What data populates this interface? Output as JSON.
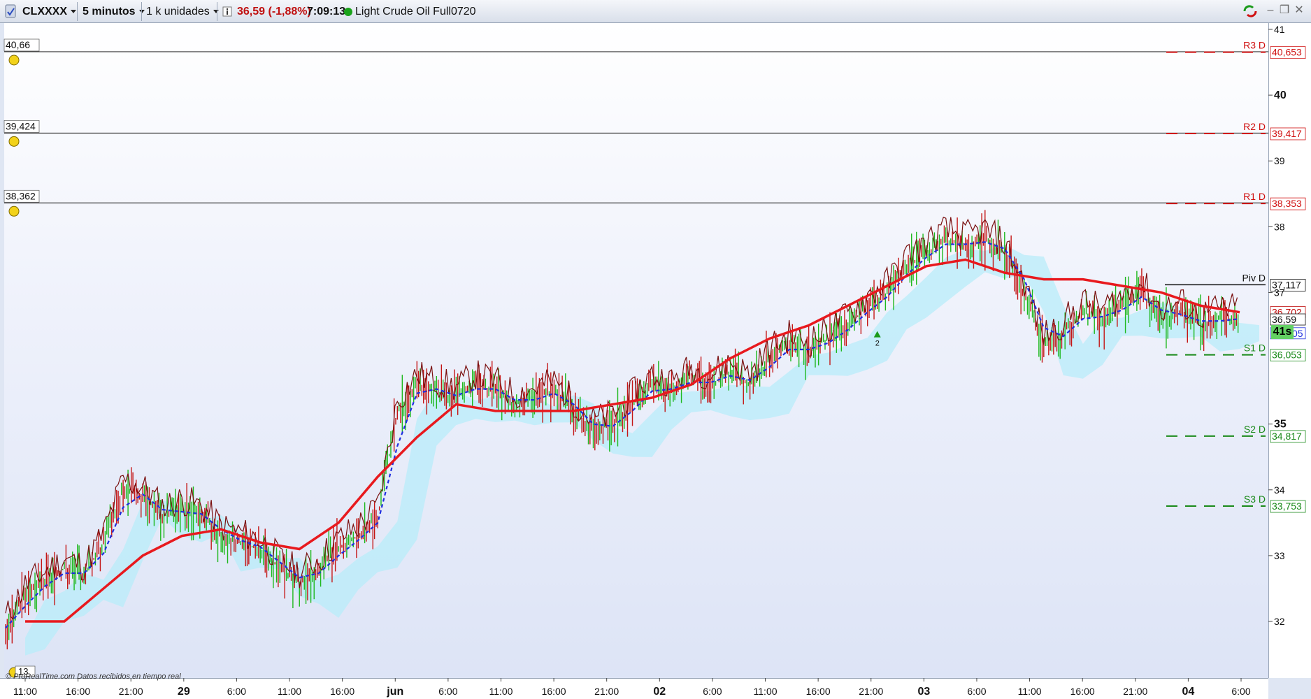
{
  "toolbar": {
    "symbol": "CLXXXX",
    "interval": "5 minutos",
    "units": "1 k unidades",
    "info_icon": "info-icon",
    "last_price": "36,59 (-1,88%)",
    "time": "7:09:13",
    "status_color": "#1aa31a",
    "instrument": "Light Crude Oil Full0720"
  },
  "watermark": {
    "brand": "© ProRealTime.com",
    "status": "Datos recibidos en tiempo real"
  },
  "countdown": "41s",
  "colors": {
    "ma": "#e8191e",
    "price_up": "#1db81d",
    "price_down": "#c41616",
    "line_dark": "#7a1010",
    "tenkan": "#1e2ee0",
    "cloud": "#b8ecfa",
    "resistance": "#d01010",
    "support": "#1a8a1a"
  },
  "chart_data": {
    "type": "line",
    "title": "Light Crude Oil Full0720",
    "y_ticks": [
      {
        "value": 41,
        "label": "41",
        "bold": false
      },
      {
        "value": 40,
        "label": "40",
        "bold": true
      },
      {
        "value": 39,
        "label": "39",
        "bold": false
      },
      {
        "value": 38,
        "label": "38",
        "bold": false
      },
      {
        "value": 37,
        "label": "37",
        "bold": false
      },
      {
        "value": 35,
        "label": "35",
        "bold": true
      },
      {
        "value": 34,
        "label": "34",
        "bold": false
      },
      {
        "value": 33,
        "label": "33",
        "bold": false
      },
      {
        "value": 32,
        "label": "32",
        "bold": false
      }
    ],
    "x_ticks": [
      {
        "label": "11:00",
        "bold": false
      },
      {
        "label": "16:00",
        "bold": false
      },
      {
        "label": "21:00",
        "bold": false
      },
      {
        "label": "29",
        "bold": true
      },
      {
        "label": "6:00",
        "bold": false
      },
      {
        "label": "11:00",
        "bold": false
      },
      {
        "label": "16:00",
        "bold": false
      },
      {
        "label": "jun",
        "bold": true
      },
      {
        "label": "6:00",
        "bold": false
      },
      {
        "label": "11:00",
        "bold": false
      },
      {
        "label": "16:00",
        "bold": false
      },
      {
        "label": "21:00",
        "bold": false
      },
      {
        "label": "02",
        "bold": true
      },
      {
        "label": "6:00",
        "bold": false
      },
      {
        "label": "11:00",
        "bold": false
      },
      {
        "label": "16:00",
        "bold": false
      },
      {
        "label": "21:00",
        "bold": false
      },
      {
        "label": "03",
        "bold": true
      },
      {
        "label": "6:00",
        "bold": false
      },
      {
        "label": "11:00",
        "bold": false
      },
      {
        "label": "16:00",
        "bold": false
      },
      {
        "label": "21:00",
        "bold": false
      },
      {
        "label": "04",
        "bold": true
      },
      {
        "label": "6:00",
        "bold": false
      }
    ],
    "ylim": [
      31.55,
      41.15
    ],
    "alert_lines": [
      {
        "label": "40,66",
        "value": 40.66
      },
      {
        "label": "39,424",
        "value": 39.424
      },
      {
        "label": "38,362",
        "value": 38.362
      }
    ],
    "pivots": [
      {
        "name": "R3 D",
        "value": 40.653,
        "label": "40,653",
        "kind": "resistance"
      },
      {
        "name": "R2 D",
        "value": 39.417,
        "label": "39,417",
        "kind": "resistance"
      },
      {
        "name": "R1 D",
        "value": 38.353,
        "label": "38,353",
        "kind": "resistance"
      },
      {
        "name": "Piv D",
        "value": 37.117,
        "label": "37,117",
        "kind": "pivot"
      },
      {
        "name": "S1 D",
        "value": 36.053,
        "label": "36,053",
        "kind": "support"
      },
      {
        "name": "S2 D",
        "value": 34.817,
        "label": "34,817",
        "kind": "support"
      },
      {
        "name": "S3 D",
        "value": 33.753,
        "label": "33,753",
        "kind": "support"
      }
    ],
    "price_tags": [
      {
        "value": 36.702,
        "label": "36,702",
        "kind": "red"
      },
      {
        "value": 36.59,
        "label": "36,59",
        "kind": "last"
      },
      {
        "value": 36.38,
        "label": "05",
        "kind": "blue"
      }
    ],
    "marker": "2",
    "bottom_left_label": "13",
    "series": [
      {
        "type": "close",
        "points": [
          [
            0,
            31.9
          ],
          [
            1,
            32.4
          ],
          [
            2,
            32.6
          ],
          [
            3,
            32.8
          ],
          [
            4,
            32.7
          ],
          [
            5,
            33.2
          ],
          [
            6,
            34.0
          ],
          [
            7,
            33.9
          ],
          [
            8,
            33.6
          ],
          [
            9,
            33.7
          ],
          [
            10,
            33.6
          ],
          [
            11,
            33.3
          ],
          [
            12,
            33.2
          ],
          [
            13,
            33.1
          ],
          [
            14,
            32.8
          ],
          [
            15,
            32.6
          ],
          [
            16,
            32.8
          ],
          [
            17,
            33.1
          ],
          [
            18,
            33.3
          ],
          [
            19,
            33.6
          ],
          [
            20,
            35.2
          ],
          [
            21,
            35.6
          ],
          [
            22,
            35.5
          ],
          [
            23,
            35.4
          ],
          [
            24,
            35.6
          ],
          [
            25,
            35.5
          ],
          [
            26,
            35.3
          ],
          [
            27,
            35.4
          ],
          [
            28,
            35.5
          ],
          [
            29,
            35.2
          ],
          [
            30,
            34.9
          ],
          [
            31,
            35.0
          ],
          [
            32,
            35.3
          ],
          [
            33,
            35.6
          ],
          [
            34,
            35.5
          ],
          [
            35,
            35.7
          ],
          [
            36,
            35.6
          ],
          [
            37,
            35.8
          ],
          [
            38,
            35.6
          ],
          [
            39,
            36.0
          ],
          [
            40,
            36.2
          ],
          [
            41,
            36.1
          ],
          [
            42,
            36.3
          ],
          [
            43,
            36.5
          ],
          [
            44,
            36.8
          ],
          [
            45,
            37.0
          ],
          [
            46,
            37.4
          ],
          [
            47,
            37.6
          ],
          [
            48,
            37.8
          ],
          [
            49,
            37.7
          ],
          [
            50,
            37.8
          ],
          [
            51,
            37.6
          ],
          [
            52,
            37.0
          ],
          [
            53,
            36.2
          ],
          [
            54,
            36.4
          ],
          [
            55,
            36.7
          ],
          [
            56,
            36.6
          ],
          [
            57,
            36.8
          ],
          [
            58,
            37.0
          ],
          [
            59,
            36.6
          ],
          [
            60,
            36.7
          ],
          [
            61,
            36.5
          ],
          [
            62,
            36.6
          ],
          [
            63,
            36.6
          ]
        ]
      },
      {
        "type": "moving_average",
        "points": [
          [
            1,
            32.0
          ],
          [
            3,
            32.0
          ],
          [
            5,
            32.5
          ],
          [
            7,
            33.0
          ],
          [
            9,
            33.3
          ],
          [
            11,
            33.4
          ],
          [
            13,
            33.2
          ],
          [
            15,
            33.1
          ],
          [
            17,
            33.5
          ],
          [
            19,
            34.2
          ],
          [
            21,
            34.8
          ],
          [
            23,
            35.3
          ],
          [
            25,
            35.2
          ],
          [
            27,
            35.2
          ],
          [
            29,
            35.2
          ],
          [
            31,
            35.3
          ],
          [
            33,
            35.4
          ],
          [
            35,
            35.6
          ],
          [
            37,
            36.0
          ],
          [
            39,
            36.3
          ],
          [
            41,
            36.5
          ],
          [
            43,
            36.8
          ],
          [
            45,
            37.1
          ],
          [
            47,
            37.4
          ],
          [
            49,
            37.5
          ],
          [
            51,
            37.3
          ],
          [
            53,
            37.2
          ],
          [
            55,
            37.2
          ],
          [
            57,
            37.1
          ],
          [
            59,
            37.0
          ],
          [
            61,
            36.8
          ],
          [
            63,
            36.7
          ]
        ]
      }
    ]
  }
}
